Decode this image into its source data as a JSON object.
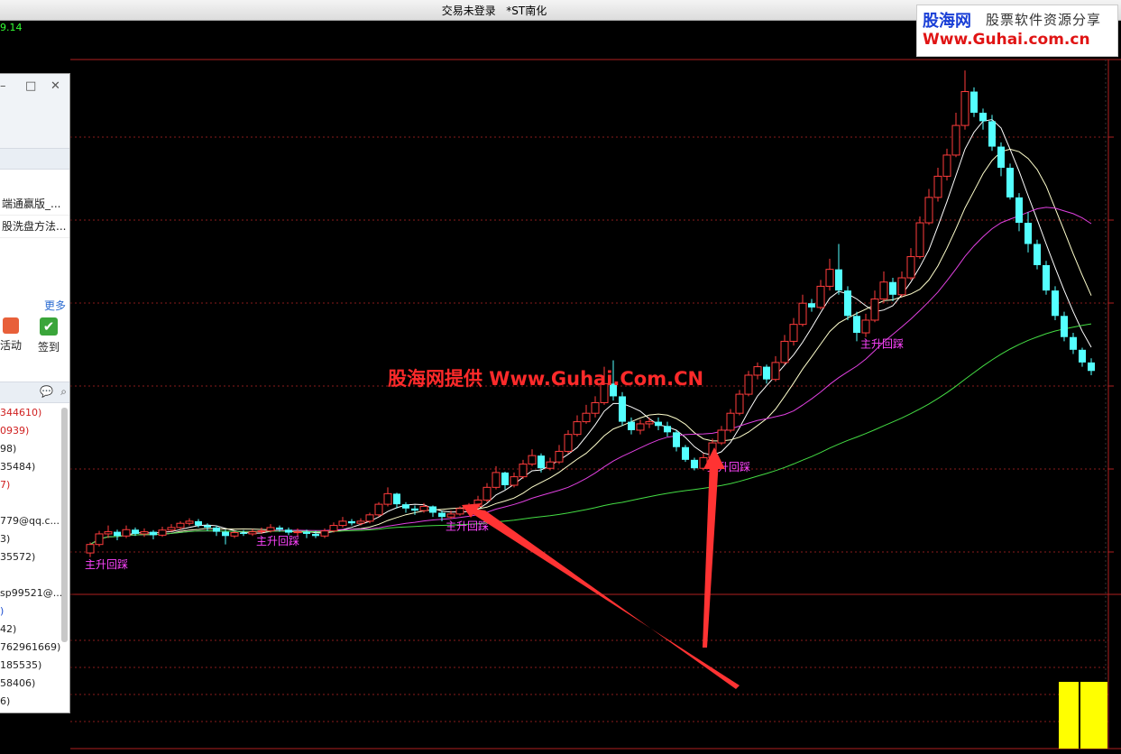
{
  "window": {
    "title": "交易未登录   *ST南化"
  },
  "top_value": "9.14",
  "watermark": {
    "line1": "股海网",
    "line2": "股票软件资源分享",
    "line3": "Www.Guhai.com.cn"
  },
  "center_watermark": "股海网提供 Www.Guhai.Com.CN",
  "signal_label": "主升回踩",
  "panel": {
    "items": [
      "端通赢版_...",
      "股洗盘方法..."
    ],
    "more": "更多",
    "tools": [
      {
        "label": "活动",
        "icon": "activity-icon"
      },
      {
        "label": "签到",
        "icon": "checkin-icon"
      }
    ],
    "contacts": [
      {
        "text": "344610)",
        "color": "#d02020"
      },
      {
        "text": "0939)",
        "color": "#d02020"
      },
      {
        "text": "98)",
        "color": "#222222"
      },
      {
        "text": "35484)",
        "color": "#222222"
      },
      {
        "text": "7)",
        "color": "#d02020"
      },
      {
        "text": "",
        "color": "#222222"
      },
      {
        "text": "779@qq.c...",
        "color": "#222222"
      },
      {
        "text": "3)",
        "color": "#222222"
      },
      {
        "text": "35572)",
        "color": "#222222"
      },
      {
        "text": "",
        "color": "#222222"
      },
      {
        "text": "sp99521@...",
        "color": "#222222"
      },
      {
        "text": ")",
        "color": "#2050d0"
      },
      {
        "text": "42)",
        "color": "#222222"
      },
      {
        "text": "762961669)",
        "color": "#222222"
      },
      {
        "text": "185535)",
        "color": "#222222"
      },
      {
        "text": "58406)",
        "color": "#222222"
      },
      {
        "text": "6)",
        "color": "#222222"
      }
    ]
  },
  "chart_data": {
    "type": "candlestick",
    "series_colors": {
      "up": "#ff3c3c",
      "down": "#54ffff",
      "ma5": "#ffffff",
      "ma10": "#ffffcc",
      "ma20": "#e040e0",
      "ma60": "#44dd44"
    },
    "candles": [
      [
        100,
        5.2,
        5.4,
        5.45,
        5.1
      ],
      [
        110,
        5.4,
        5.65,
        5.72,
        5.35
      ],
      [
        120,
        5.65,
        5.7,
        5.85,
        5.55
      ],
      [
        130,
        5.7,
        5.6,
        5.75,
        5.5
      ],
      [
        140,
        5.6,
        5.75,
        5.85,
        5.55
      ],
      [
        150,
        5.75,
        5.65,
        5.8,
        5.6
      ],
      [
        160,
        5.65,
        5.7,
        5.78,
        5.58
      ],
      [
        170,
        5.7,
        5.62,
        5.74,
        5.52
      ],
      [
        180,
        5.62,
        5.74,
        5.82,
        5.58
      ],
      [
        190,
        5.74,
        5.8,
        5.88,
        5.7
      ],
      [
        200,
        5.8,
        5.9,
        5.95,
        5.75
      ],
      [
        210,
        5.9,
        5.95,
        6.02,
        5.85
      ],
      [
        220,
        5.95,
        5.85,
        6.0,
        5.8
      ],
      [
        230,
        5.85,
        5.8,
        5.9,
        5.72
      ],
      [
        240,
        5.8,
        5.7,
        5.85,
        5.6
      ],
      [
        250,
        5.7,
        5.6,
        5.75,
        5.4
      ],
      [
        260,
        5.6,
        5.68,
        5.72,
        5.55
      ],
      [
        270,
        5.68,
        5.65,
        5.74,
        5.6
      ],
      [
        280,
        5.65,
        5.7,
        5.76,
        5.6
      ],
      [
        290,
        5.7,
        5.72,
        5.8,
        5.65
      ],
      [
        300,
        5.72,
        5.8,
        5.88,
        5.68
      ],
      [
        310,
        5.8,
        5.75,
        5.85,
        5.7
      ],
      [
        320,
        5.75,
        5.68,
        5.8,
        5.62
      ],
      [
        330,
        5.68,
        5.7,
        5.78,
        5.6
      ],
      [
        340,
        5.7,
        5.65,
        5.75,
        5.55
      ],
      [
        350,
        5.65,
        5.6,
        5.72,
        5.55
      ],
      [
        360,
        5.6,
        5.72,
        5.78,
        5.55
      ],
      [
        370,
        5.72,
        5.85,
        5.92,
        5.68
      ],
      [
        380,
        5.85,
        5.95,
        6.05,
        5.8
      ],
      [
        390,
        5.95,
        5.9,
        6.0,
        5.85
      ],
      [
        400,
        5.9,
        5.95,
        6.02,
        5.85
      ],
      [
        410,
        5.95,
        6.1,
        6.15,
        5.9
      ],
      [
        420,
        6.1,
        6.35,
        6.4,
        6.05
      ],
      [
        430,
        6.35,
        6.6,
        6.75,
        6.3
      ],
      [
        440,
        6.6,
        6.35,
        6.62,
        6.25
      ],
      [
        450,
        6.35,
        6.25,
        6.4,
        6.15
      ],
      [
        460,
        6.25,
        6.2,
        6.32,
        6.1
      ],
      [
        470,
        6.2,
        6.3,
        6.38,
        6.15
      ],
      [
        480,
        6.3,
        6.15,
        6.32,
        6.05
      ],
      [
        490,
        6.15,
        6.05,
        6.2,
        5.95
      ],
      [
        500,
        6.05,
        6.12,
        6.2,
        6.0
      ],
      [
        510,
        6.12,
        6.25,
        6.3,
        6.08
      ],
      [
        520,
        6.25,
        6.3,
        6.38,
        6.2
      ],
      [
        530,
        6.3,
        6.45,
        6.55,
        6.25
      ],
      [
        540,
        6.45,
        6.75,
        6.85,
        6.4
      ],
      [
        550,
        6.75,
        7.1,
        7.25,
        6.7
      ],
      [
        560,
        7.1,
        6.8,
        7.12,
        6.7
      ],
      [
        570,
        6.8,
        7.0,
        7.1,
        6.75
      ],
      [
        580,
        7.0,
        7.3,
        7.4,
        6.95
      ],
      [
        590,
        7.3,
        7.5,
        7.65,
        7.25
      ],
      [
        600,
        7.5,
        7.2,
        7.55,
        7.1
      ],
      [
        610,
        7.2,
        7.35,
        7.45,
        7.15
      ],
      [
        620,
        7.35,
        7.6,
        7.75,
        7.3
      ],
      [
        630,
        7.6,
        8.0,
        8.1,
        7.55
      ],
      [
        640,
        8.0,
        8.3,
        8.45,
        7.95
      ],
      [
        650,
        8.3,
        8.5,
        8.7,
        8.25
      ],
      [
        660,
        8.5,
        8.75,
        8.9,
        8.4
      ],
      [
        670,
        8.75,
        9.2,
        9.6,
        8.7
      ],
      [
        680,
        9.2,
        8.9,
        9.75,
        8.8
      ],
      [
        690,
        8.9,
        8.3,
        9.0,
        8.2
      ],
      [
        700,
        8.3,
        8.1,
        8.4,
        8.0
      ],
      [
        710,
        8.1,
        8.25,
        8.35,
        8.0
      ],
      [
        720,
        8.25,
        8.3,
        8.4,
        8.15
      ],
      [
        730,
        8.3,
        8.2,
        8.4,
        8.1
      ],
      [
        740,
        8.2,
        8.05,
        8.3,
        7.95
      ],
      [
        750,
        8.05,
        7.7,
        8.1,
        7.6
      ],
      [
        760,
        7.7,
        7.4,
        7.75,
        7.35
      ],
      [
        770,
        7.4,
        7.2,
        7.45,
        7.15
      ],
      [
        780,
        7.2,
        7.45,
        7.55,
        7.15
      ],
      [
        790,
        7.45,
        7.8,
        7.9,
        7.4
      ],
      [
        800,
        7.8,
        8.1,
        8.2,
        7.75
      ],
      [
        810,
        8.1,
        8.5,
        8.6,
        8.05
      ],
      [
        820,
        8.5,
        8.95,
        9.05,
        8.45
      ],
      [
        830,
        8.95,
        9.4,
        9.5,
        8.9
      ],
      [
        840,
        9.4,
        9.6,
        9.7,
        9.3
      ],
      [
        850,
        9.6,
        9.3,
        9.65,
        9.2
      ],
      [
        860,
        9.3,
        9.7,
        9.85,
        9.25
      ],
      [
        870,
        9.7,
        10.2,
        10.35,
        9.65
      ],
      [
        880,
        10.2,
        10.6,
        10.75,
        10.1
      ],
      [
        890,
        10.6,
        11.1,
        11.3,
        10.55
      ],
      [
        900,
        11.1,
        11.0,
        11.2,
        10.9
      ],
      [
        910,
        11.0,
        11.5,
        11.65,
        10.95
      ],
      [
        920,
        11.5,
        11.9,
        12.15,
        11.4
      ],
      [
        930,
        11.9,
        11.4,
        12.5,
        11.3
      ],
      [
        940,
        11.4,
        10.8,
        11.5,
        10.7
      ],
      [
        950,
        10.8,
        10.4,
        10.9,
        10.2
      ],
      [
        960,
        10.4,
        10.7,
        10.85,
        10.3
      ],
      [
        970,
        10.7,
        11.2,
        11.4,
        10.65
      ],
      [
        980,
        11.2,
        11.6,
        11.85,
        11.1
      ],
      [
        990,
        11.6,
        11.3,
        11.7,
        11.15
      ],
      [
        1000,
        11.3,
        11.7,
        11.85,
        11.25
      ],
      [
        1010,
        11.7,
        12.2,
        12.4,
        11.65
      ],
      [
        1020,
        12.2,
        13.0,
        13.15,
        12.15
      ],
      [
        1030,
        13.0,
        13.6,
        13.8,
        12.95
      ],
      [
        1040,
        13.6,
        14.1,
        14.3,
        13.5
      ],
      [
        1050,
        14.1,
        14.6,
        14.75,
        14.0
      ],
      [
        1060,
        14.6,
        15.3,
        15.6,
        14.55
      ],
      [
        1070,
        15.3,
        16.1,
        16.6,
        15.2
      ],
      [
        1080,
        16.1,
        15.6,
        16.2,
        15.5
      ],
      [
        1090,
        15.6,
        15.4,
        15.7,
        15.2
      ],
      [
        1100,
        15.4,
        14.8,
        15.55,
        14.7
      ],
      [
        1110,
        14.8,
        14.3,
        14.9,
        14.1
      ],
      [
        1120,
        14.3,
        13.6,
        14.4,
        13.55
      ],
      [
        1130,
        13.6,
        13.0,
        13.7,
        12.8
      ],
      [
        1140,
        13.0,
        12.5,
        13.25,
        12.3
      ],
      [
        1150,
        12.5,
        12.0,
        12.6,
        11.9
      ],
      [
        1160,
        12.0,
        11.4,
        12.1,
        11.3
      ],
      [
        1170,
        11.4,
        10.8,
        11.5,
        10.7
      ],
      [
        1180,
        10.8,
        10.3,
        10.9,
        10.2
      ],
      [
        1190,
        10.3,
        10.0,
        10.4,
        9.9
      ],
      [
        1200,
        10.0,
        9.7,
        10.05,
        9.6
      ],
      [
        1210,
        9.7,
        9.5,
        9.8,
        9.4
      ]
    ],
    "signals": [
      100,
      290,
      500,
      790,
      960
    ]
  }
}
